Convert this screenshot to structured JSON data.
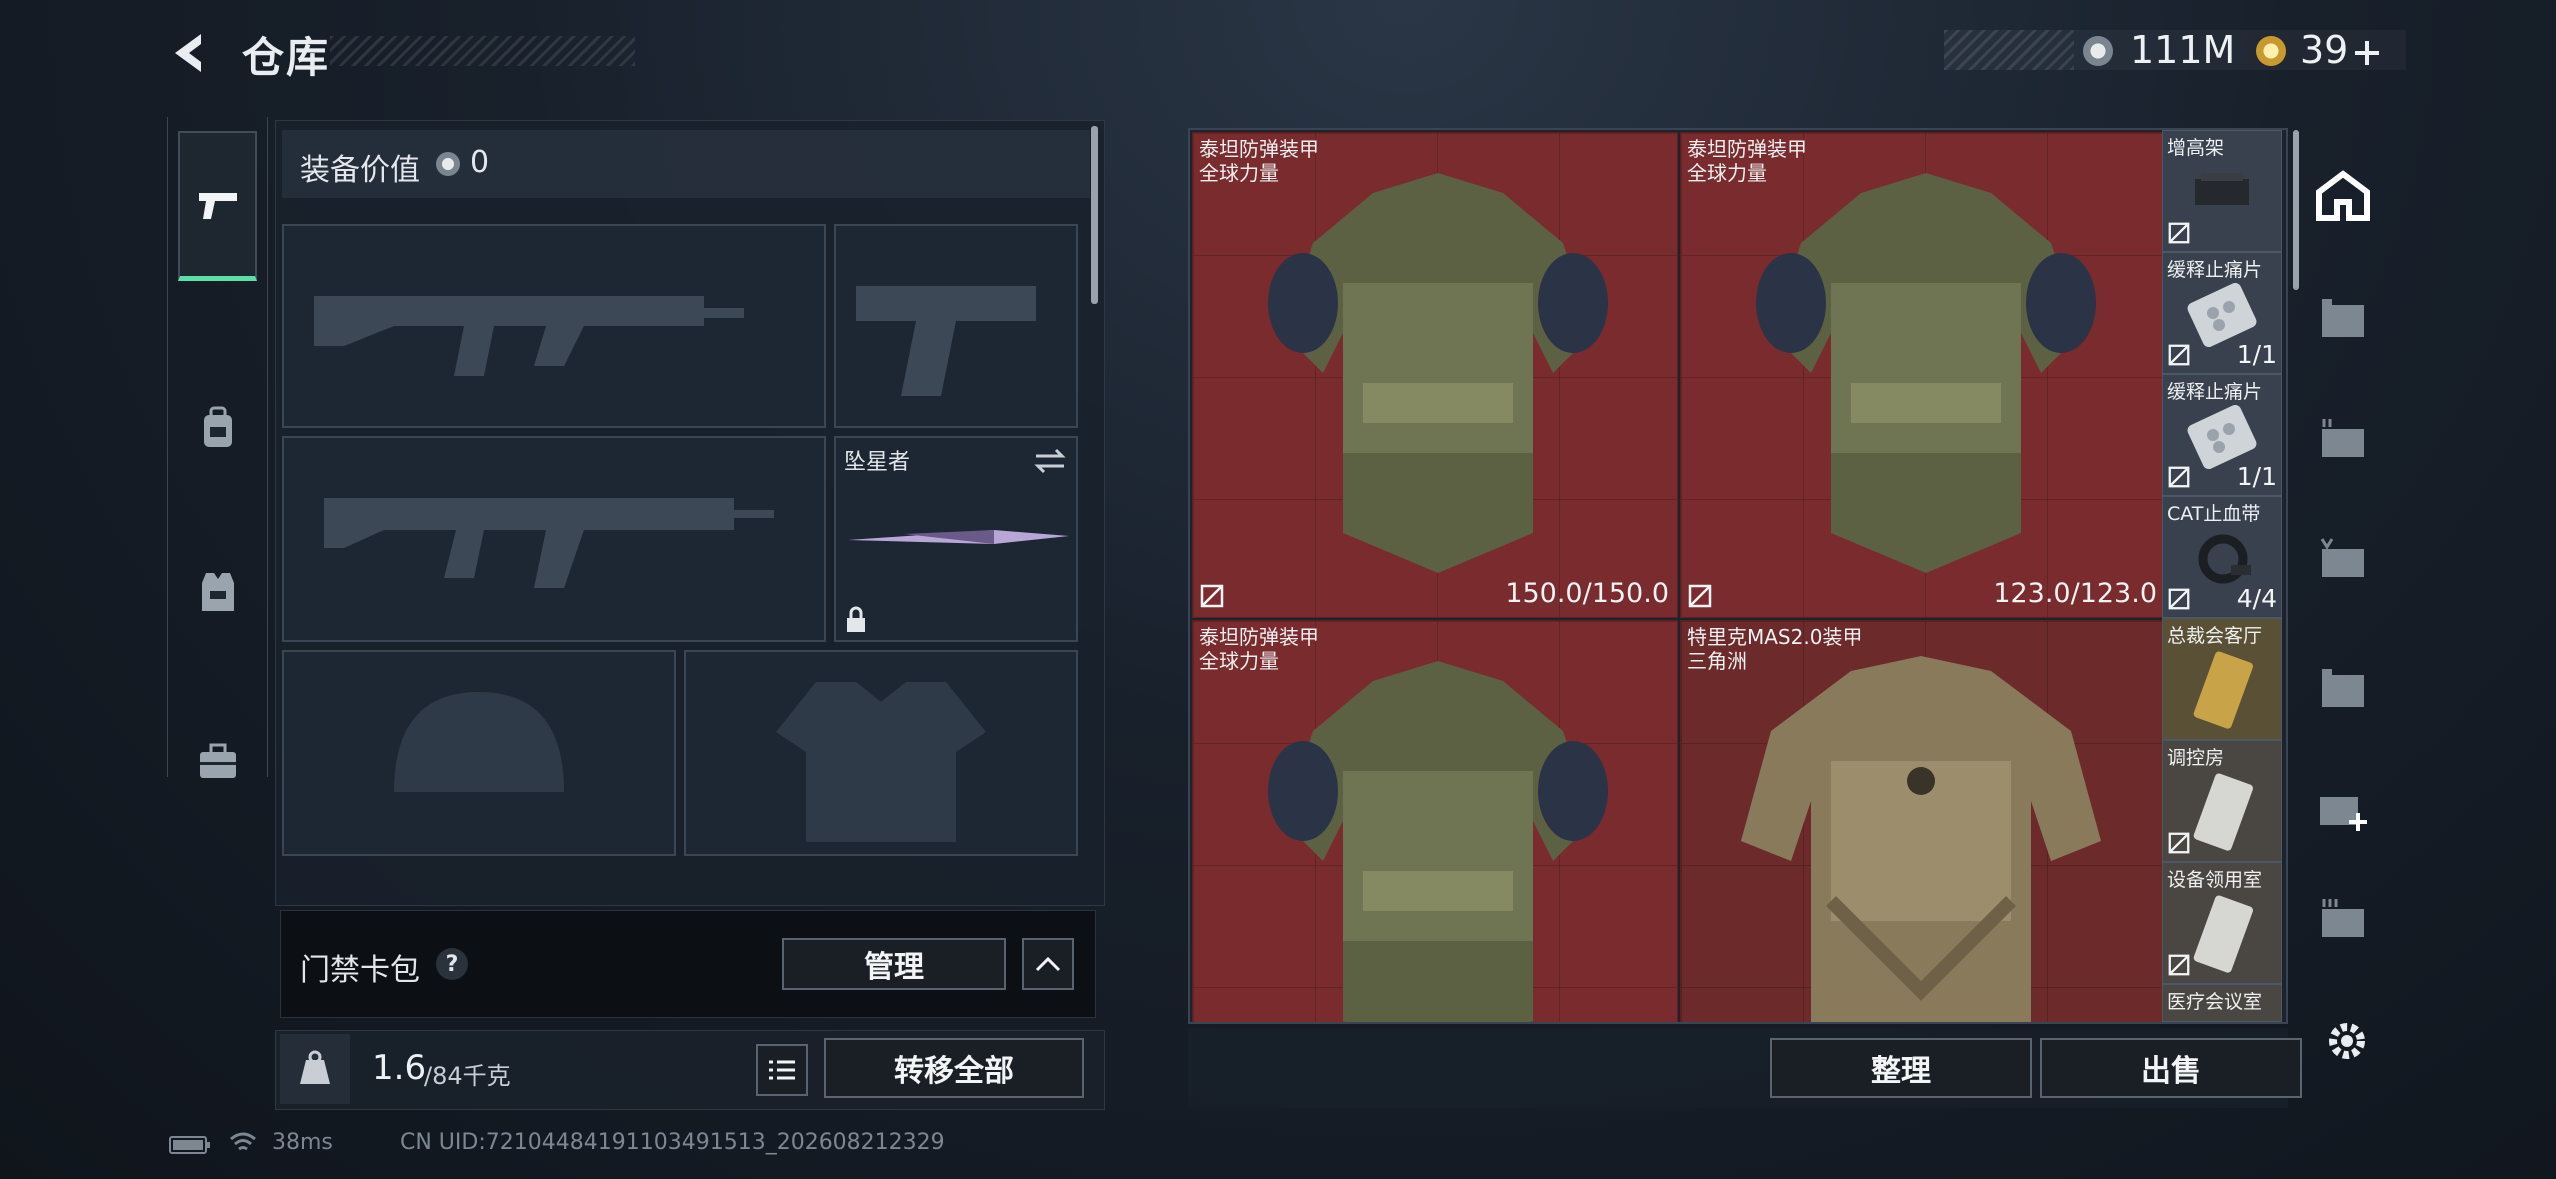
{
  "header": {
    "title": "仓库"
  },
  "currency": [
    {
      "icon": "silver-coin-icon",
      "value": "111M"
    },
    {
      "icon": "gold-coin-icon",
      "value": "39"
    }
  ],
  "left_nav": {
    "items": [
      {
        "icon": "pistol-icon",
        "active": true
      },
      {
        "icon": "backpack-icon",
        "active": false
      },
      {
        "icon": "vest-icon",
        "active": false
      },
      {
        "icon": "briefcase-icon",
        "active": false
      }
    ]
  },
  "loadout": {
    "value_label": "装备价值",
    "value": "0",
    "melee_name": "坠星者",
    "access_card_label": "门禁卡包",
    "help": "?",
    "manage_label": "管理"
  },
  "capacity": {
    "current": "1.6",
    "max": "/84千克",
    "transfer_all_label": "转移全部"
  },
  "stash": {
    "armors": [
      {
        "name": "泰坦防弹装甲",
        "sub": "全球力量",
        "durability": "150.0/150.0"
      },
      {
        "name": "泰坦防弹装甲",
        "sub": "全球力量",
        "durability": "123.0/123.0"
      },
      {
        "name": "泰坦防弹装甲",
        "sub": "全球力量",
        "durability": ""
      },
      {
        "name": "特里克MAS2.0装甲",
        "sub": "三角洲",
        "durability": ""
      }
    ],
    "small_items": [
      {
        "name": "增高架",
        "count": ""
      },
      {
        "name": "缓释止痛片",
        "count": "1/1"
      },
      {
        "name": "缓释止痛片",
        "count": "1/1"
      },
      {
        "name": "CAT止血带",
        "count": "4/4"
      },
      {
        "name": "总裁会客厅",
        "count": ""
      },
      {
        "name": "调控房",
        "count": ""
      },
      {
        "name": "设备领用室",
        "count": ""
      },
      {
        "name": "医疗会议室",
        "count": ""
      }
    ],
    "sort_label": "整理",
    "sell_label": "出售"
  },
  "status": {
    "ping": "38ms",
    "uid": "CN UID:7210448419110349151​3_202608212329"
  },
  "colors": {
    "accent": "#56e0a6",
    "slot_red": "#7a2b2d",
    "panel": "#19212b"
  }
}
